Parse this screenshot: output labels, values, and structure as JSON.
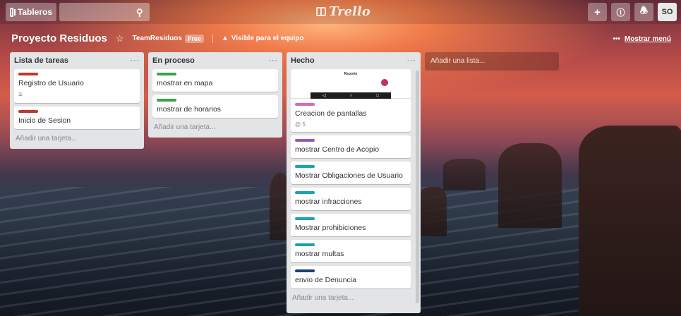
{
  "header": {
    "boards_label": "Tableros",
    "search_value": "",
    "logo_text": "Trello",
    "add_icon": "plus-icon",
    "info_icon": "info-icon",
    "bell_icon": "bell-icon",
    "avatar_initials": "SO"
  },
  "board": {
    "title": "Proyecto Residuos",
    "team": "TeamResiduos",
    "team_badge": "Free",
    "visibility": "Visible para el equipo",
    "menu_dots": "•••",
    "menu_label": "Mostrar menú"
  },
  "lists": [
    {
      "title": "Lista de tareas",
      "menu": "···",
      "cards": [
        {
          "label_color": "#c0392b",
          "title": "Registro de Usuario",
          "badge": "≡"
        },
        {
          "label_color": "#c0392b",
          "title": "Inicio de Sesion"
        }
      ],
      "add_card": "Añadir una tarjeta..."
    },
    {
      "title": "En proceso",
      "menu": "···",
      "cards": [
        {
          "label_color": "#3aa346",
          "title": "mostrar en mapa"
        },
        {
          "label_color": "#3aa346",
          "title": "mostrar de horarios"
        }
      ],
      "add_card": "Añadir una tarjeta..."
    },
    {
      "title": "Hecho",
      "menu": "···",
      "cover": {
        "title": "Reporte"
      },
      "cards": [
        {
          "label_color": "#d36bc4",
          "title": "Creacion de pantallas",
          "badge": "@ 5"
        },
        {
          "label_color": "#9b59b6",
          "title": "mostrar Centro de Acopio"
        },
        {
          "label_color": "#1aa2b8",
          "title": "Mostrar Obligaciones de Usuario"
        },
        {
          "label_color": "#1aa2b8",
          "title": "mostrar infracciones"
        },
        {
          "label_color": "#1aa2b8",
          "title": "Mostrar prohibiciones"
        },
        {
          "label_color": "#1aa2b8",
          "title": "mostrar multas"
        },
        {
          "label_color": "#1f3f7a",
          "title": "envio de Denuncia"
        }
      ],
      "add_card": "Añadir una tarjeta..."
    }
  ],
  "add_list": "Añadir una lista..."
}
